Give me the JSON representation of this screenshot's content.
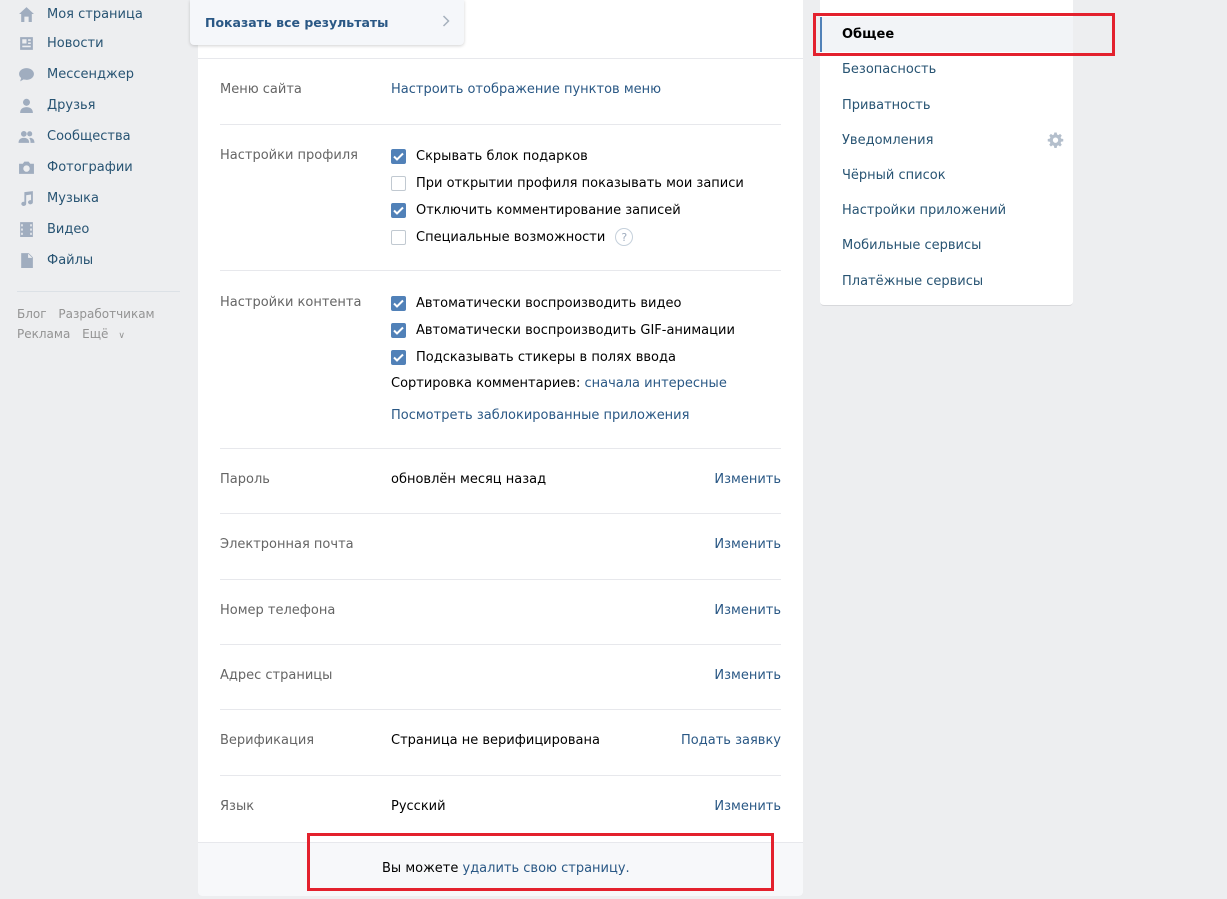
{
  "left_nav": {
    "items": [
      {
        "label": "Моя страница",
        "icon": "home-icon"
      },
      {
        "label": "Новости",
        "icon": "news-icon"
      },
      {
        "label": "Мессенджер",
        "icon": "messenger-icon"
      },
      {
        "label": "Друзья",
        "icon": "friends-icon"
      },
      {
        "label": "Сообщества",
        "icon": "communities-icon"
      },
      {
        "label": "Фотографии",
        "icon": "camera-icon"
      },
      {
        "label": "Музыка",
        "icon": "music-icon"
      },
      {
        "label": "Видео",
        "icon": "video-icon"
      },
      {
        "label": "Файлы",
        "icon": "file-icon"
      }
    ],
    "footer": {
      "blog": "Блог",
      "developers": "Разработчикам",
      "ads": "Реклама",
      "more": "Ещё"
    }
  },
  "search_popup": {
    "label": "Показать все результаты"
  },
  "settings": {
    "site_menu": {
      "label": "Меню сайта",
      "link": "Настроить отображение пунктов меню"
    },
    "profile": {
      "label": "Настройки профиля",
      "options": [
        {
          "text": "Скрывать блок подарков",
          "checked": true
        },
        {
          "text": "При открытии профиля показывать мои записи",
          "checked": false
        },
        {
          "text": "Отключить комментирование записей",
          "checked": true
        },
        {
          "text": "Специальные возможности",
          "checked": false
        }
      ],
      "help": "?"
    },
    "content": {
      "label": "Настройки контента",
      "options": [
        {
          "text": "Автоматически воспроизводить видео",
          "checked": true
        },
        {
          "text": "Автоматически воспроизводить GIF-анимации",
          "checked": true
        },
        {
          "text": "Подсказывать стикеры в полях ввода",
          "checked": true
        }
      ],
      "sort_label": "Сортировка комментариев:",
      "sort_value": "сначала интересные",
      "blocked_apps": "Посмотреть заблокированные приложения"
    },
    "rows": [
      {
        "label": "Пароль",
        "value": "обновлён месяц назад",
        "action": "Изменить"
      },
      {
        "label": "Электронная почта",
        "value": "",
        "action": "Изменить"
      },
      {
        "label": "Номер телефона",
        "value": "",
        "action": "Изменить"
      },
      {
        "label": "Адрес страницы",
        "value": "",
        "action": "Изменить"
      },
      {
        "label": "Верификация",
        "value": "Страница не верифицирована",
        "action": "Подать заявку"
      },
      {
        "label": "Язык",
        "value": "Русский",
        "action": "Изменить"
      }
    ],
    "delete": {
      "prefix": "Вы можете",
      "link": "удалить свою страницу."
    }
  },
  "right_menu": {
    "items": [
      {
        "label": "Общее",
        "active": true
      },
      {
        "label": "Безопасность"
      },
      {
        "label": "Приватность"
      },
      {
        "label": "Уведомления"
      },
      {
        "label": "Чёрный список"
      },
      {
        "label": "Настройки приложений"
      },
      {
        "label": "Мобильные сервисы"
      },
      {
        "label": "Платёжные сервисы"
      }
    ]
  },
  "colors": {
    "link": "#2a5885",
    "checkbox": "#5181b8",
    "highlight": "#e3212d",
    "background": "#edeef0"
  }
}
